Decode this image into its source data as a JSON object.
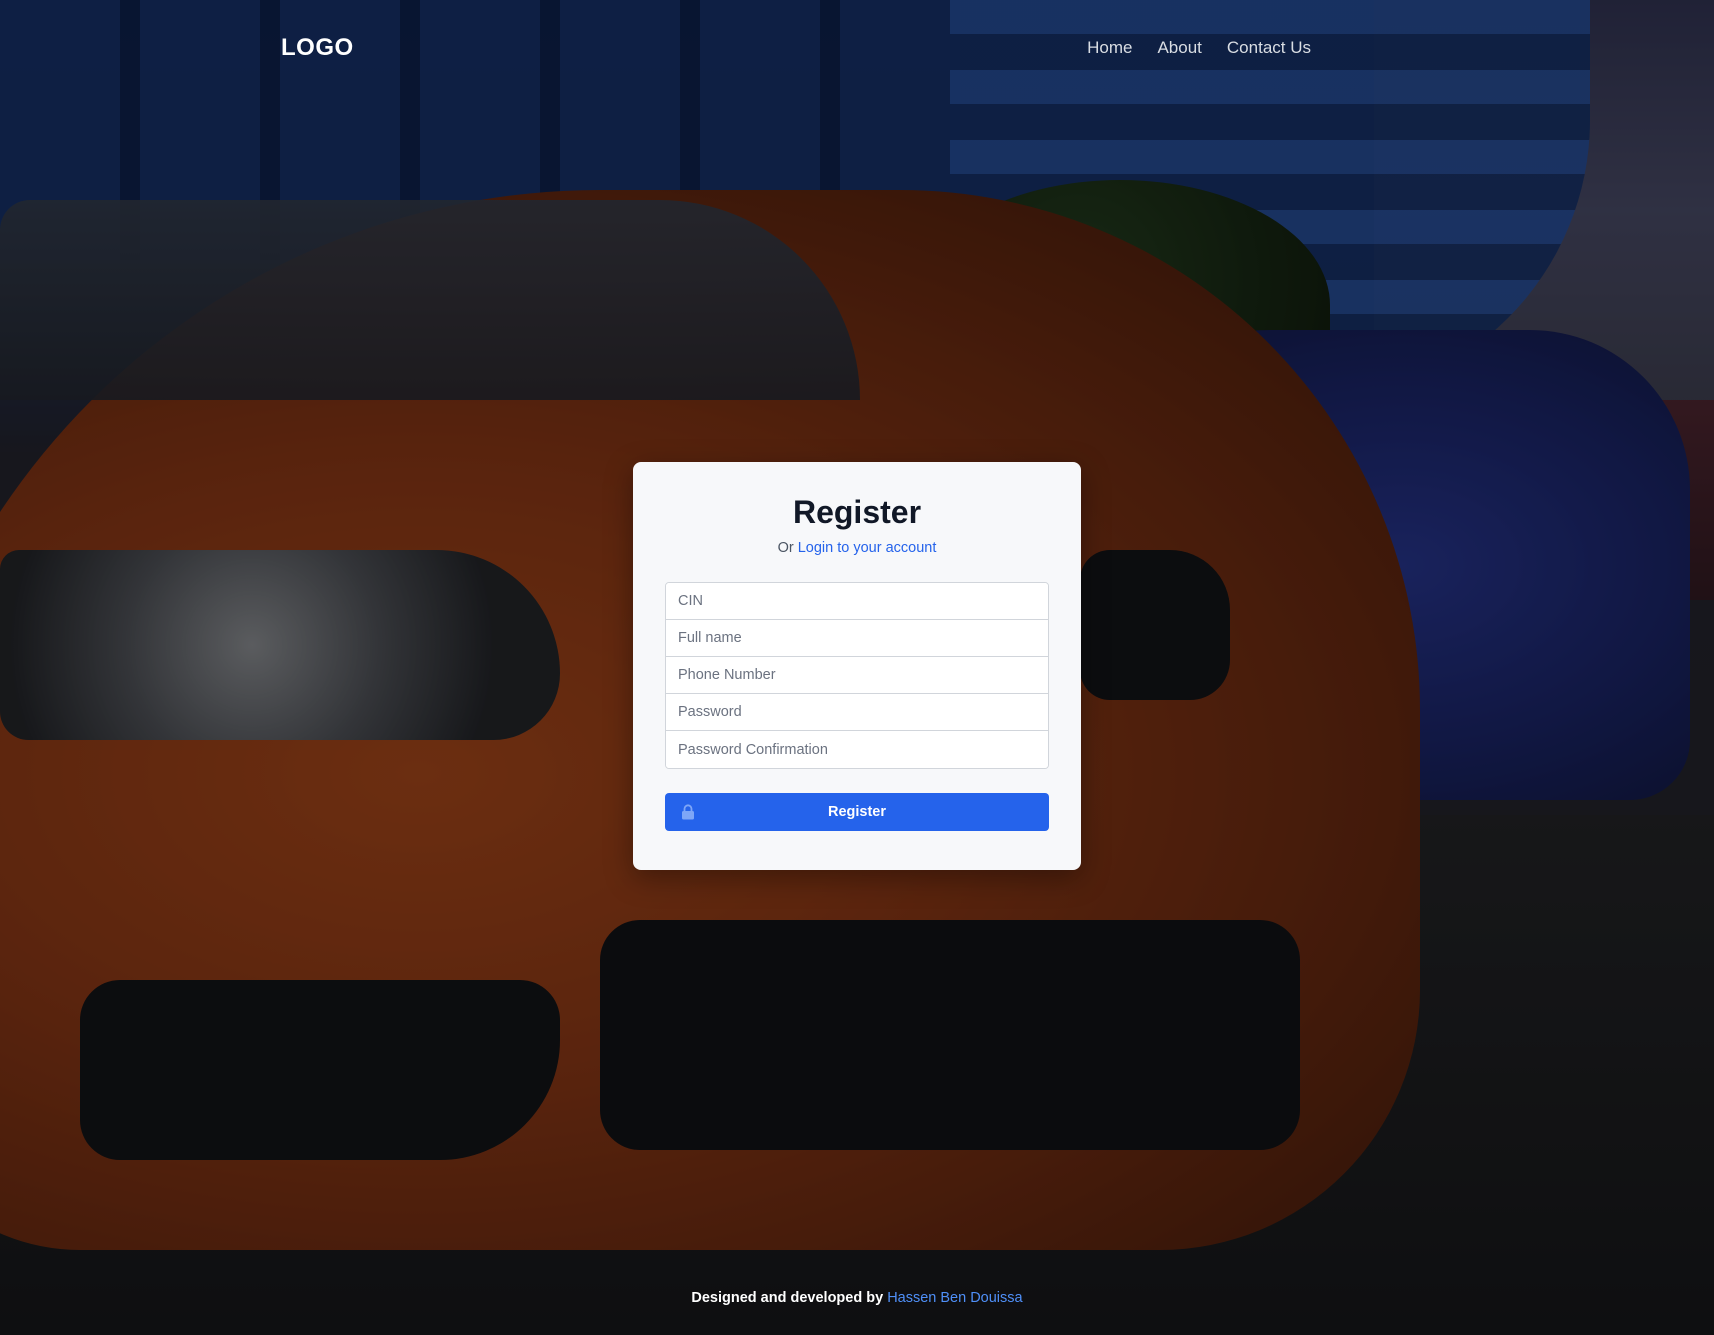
{
  "navbar": {
    "logo": "LOGO",
    "links": [
      {
        "label": "Home"
      },
      {
        "label": "About"
      },
      {
        "label": "Contact Us"
      }
    ]
  },
  "register_card": {
    "title": "Register",
    "subtitle_prefix": "Or",
    "login_link": "Login to your account",
    "fields": [
      {
        "placeholder": "CIN",
        "value": ""
      },
      {
        "placeholder": "Full name",
        "value": ""
      },
      {
        "placeholder": "Phone Number",
        "value": ""
      },
      {
        "placeholder": "Password",
        "value": ""
      },
      {
        "placeholder": "Password Confirmation",
        "value": ""
      }
    ],
    "submit_label": "Register",
    "submit_icon": "lock-icon"
  },
  "footer": {
    "text": "Designed and developed by",
    "author": "Hassen Ben Douissa"
  },
  "colors": {
    "accent": "#2563eb",
    "footer_link": "#4f8ff7",
    "card_bg": "#f7f8fa",
    "title_text": "#111827"
  }
}
